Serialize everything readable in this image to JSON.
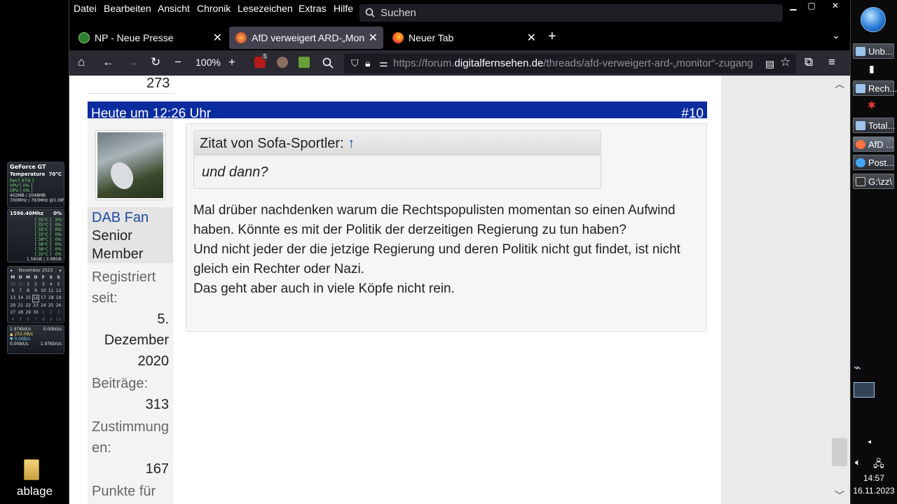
{
  "desktop": {
    "gpu_gadget": {
      "title": "GeForce GT",
      "temp_label": "Temperature",
      "temp_value": "70°C",
      "lines": [
        "Fan [ 47% ]",
        "VPU [ 0% ]",
        "GPU [ 0% ]",
        "402MB / 2048MB",
        "700MHz / 793MHz @1.08V"
      ]
    },
    "cpu_gadget": {
      "freq": "1596.40Mhz",
      "percent": "0%",
      "cores": [
        {
          "temp": "[ 35°C ]",
          "load": "2%"
        },
        {
          "temp": "[ 35°C ]",
          "load": "0%"
        },
        {
          "temp": "[ 35°C ]",
          "load": "0%"
        },
        {
          "temp": "[ 35°C ]",
          "load": "0%"
        },
        {
          "temp": "[ 38°C ]",
          "load": "0%"
        },
        {
          "temp": "[ 38°C ]",
          "load": "0%"
        },
        {
          "temp": "[ 38°C ]",
          "load": "0%"
        },
        {
          "temp": "[ 35°C ]",
          "load": "0%"
        }
      ],
      "memory": "1.56GB / 3.98GB"
    },
    "calendar": {
      "month": "November 2023",
      "weekdays": [
        "M",
        "D",
        "M",
        "D",
        "F",
        "S",
        "S"
      ],
      "days": [
        "30",
        "31",
        "1",
        "2",
        "3",
        "4",
        "5",
        "6",
        "7",
        "8",
        "9",
        "10",
        "11",
        "12",
        "13",
        "14",
        "15",
        "16",
        "17",
        "18",
        "19",
        "20",
        "21",
        "22",
        "23",
        "24",
        "25",
        "26",
        "27",
        "28",
        "29",
        "30",
        "1",
        "2",
        "3",
        "4",
        "5",
        "6",
        "7",
        "8",
        "9",
        "10"
      ]
    },
    "network": {
      "down_rate": "1.97Kbit/s",
      "up_rate": "0.00bit/s",
      "up": "252.0B/s",
      "down": "0.00B/s",
      "bottom_left": "0.00bit/s",
      "bottom_right": "1.97Kbit/s"
    },
    "folder_label": "ablage"
  },
  "browser": {
    "menu": [
      "Datei",
      "Bearbeiten",
      "Ansicht",
      "Chronik",
      "Lesezeichen",
      "Extras",
      "Hilfe"
    ],
    "search_placeholder": "Suchen",
    "tabs": [
      {
        "label": "NP - Neue Presse",
        "active": false
      },
      {
        "label": "AfD verweigert ARD-„Monitor“",
        "active": true
      },
      {
        "label": "Neuer Tab",
        "active": false
      }
    ],
    "zoom": "100%",
    "ublock_count": "5",
    "url_prefix": "https://forum.",
    "url_domain": "digitalfernsehen.de",
    "url_path": "/threads/afd-verweigert-ard-„monitor“-zugang"
  },
  "post": {
    "previous_count": "273",
    "date": "Heute um 12:26 Uhr",
    "number": "#10",
    "user": {
      "name": "DAB Fan",
      "title": "Senior Member",
      "registered_label": "Registriert seit:",
      "registered_value": "5. Dezember 2020",
      "posts_label": "Beiträge:",
      "posts_value": "313",
      "likes_label": "Zustimmungen:",
      "likes_value": "167",
      "points_label": "Punkte für"
    },
    "quote_author": "Zitat von Sofa-Sportler:",
    "quote_arrow": "↑",
    "quote_text": "und dann?",
    "message_lines": [
      "Mal drüber nachdenken warum die Rechtspopulisten momentan so einen Aufwind haben. Könnte es mit der Politik der derzeitigen Regierung zu tun haben?",
      "Und nicht jeder der die jetzige Regierung und deren Politik nicht gut findet, ist nicht gleich ein Rechter oder Nazi.",
      "Das geht aber auch in viele Köpfe nicht rein."
    ]
  },
  "taskbar": {
    "buttons": [
      {
        "label": "Unb..."
      },
      {
        "label": "Rech..."
      },
      {
        "label": "Total..."
      },
      {
        "label": "AfD ..."
      },
      {
        "label": "Post..."
      },
      {
        "label": "G:\\zz\\"
      }
    ],
    "time": "14:57",
    "date": "16.11.2023"
  }
}
